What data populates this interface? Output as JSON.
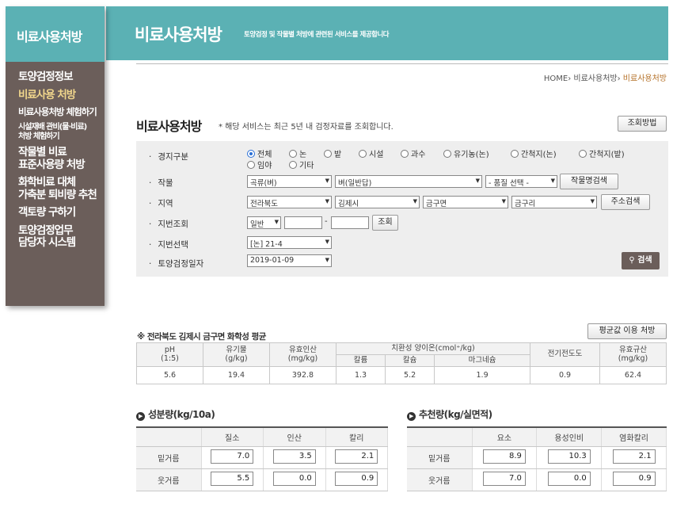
{
  "header": {
    "title": "비료사용처방",
    "subtitle": "토양검정 및 작물별 처방에 관련된 서비스를 제공합니다"
  },
  "sidebar": {
    "title": "비료사용처방",
    "items": [
      {
        "label": "토양검정정보"
      },
      {
        "label": "비료사용 처방"
      },
      {
        "label": "비료사용처방 체험하기"
      },
      {
        "label_line1": "시설재배 관비(물·비료)",
        "label_line2": "처방 체험하기"
      },
      {
        "label_line1": "작물별 비료",
        "label_line2": "표준사용량 처방"
      },
      {
        "label_line1": "화학비료 대체",
        "label_line2": "가축분 퇴비량 추천"
      },
      {
        "label": "객토량 구하기"
      },
      {
        "label_line1": "토양검정업무",
        "label_line2": "담당자 시스템"
      }
    ]
  },
  "breadcrumb": {
    "home": "HOME",
    "level1": "비료사용처방",
    "current": "비료사용처방"
  },
  "page": {
    "title": "비료사용처방",
    "note": "* 해당 서비스는 최근 5년 내 검정자료를 조회합니다.",
    "help_button": "조회방법"
  },
  "form": {
    "labels": {
      "field_type": "경지구분",
      "crop": "작물",
      "region": "지역",
      "lot_lookup": "지번조회",
      "lot_select": "지번선택",
      "test_date": "토양검정일자"
    },
    "field_types": [
      "전체",
      "논",
      "밭",
      "시설",
      "과수",
      "유기농(논)",
      "간척지(논)",
      "간척지(밭)",
      "임야",
      "기타"
    ],
    "crop_category": "곡류(벼)",
    "crop": "벼(일반답)",
    "variety": "- 품질 선택 -",
    "crop_search_button": "작물명검색",
    "province": "전라북도",
    "city": "김제시",
    "town": "금구면",
    "village": "금구리",
    "address_search_button": "주소검색",
    "lot_type": "일반",
    "lot_sep": "-",
    "lot_lookup_button": "조회",
    "lot_selected": "[논] 21-4",
    "test_date": "2019-01-09",
    "search_button": "검색"
  },
  "avg": {
    "title": "※ 전라북도 김제시 금구면 화학성 평균",
    "button": "평균값 이용 처방",
    "headers": {
      "ph": "pH",
      "ph_unit": "(1:5)",
      "om": "유기물",
      "om_unit": "(g/kg)",
      "p": "유효인산",
      "p_unit": "(mg/kg)",
      "cation": "치환성 양이온(cmol⁺/kg)",
      "k": "칼륨",
      "ca": "칼슘",
      "mg": "마그네슘",
      "ec": "전기전도도",
      "si": "유효규산",
      "si_unit": "(mg/kg)"
    },
    "values": {
      "ph": "5.6",
      "om": "19.4",
      "p": "392.8",
      "k": "1.3",
      "ca": "5.2",
      "mg": "1.9",
      "ec": "0.9",
      "si": "62.4"
    }
  },
  "component": {
    "title": "성분량(kg/10a)",
    "columns": [
      "질소",
      "인산",
      "칼리"
    ],
    "rows": [
      {
        "label": "밑거름",
        "values": [
          "7.0",
          "3.5",
          "2.1"
        ]
      },
      {
        "label": "웃거름",
        "values": [
          "5.5",
          "0.0",
          "0.9"
        ]
      }
    ]
  },
  "recommend": {
    "title": "추천량(kg/실면적)",
    "columns": [
      "요소",
      "용성인비",
      "염화칼리"
    ],
    "rows": [
      {
        "label": "밑거름",
        "values": [
          "8.9",
          "10.3",
          "2.1"
        ]
      },
      {
        "label": "웃거름",
        "values": [
          "7.0",
          "0.0",
          "0.9"
        ]
      }
    ]
  }
}
